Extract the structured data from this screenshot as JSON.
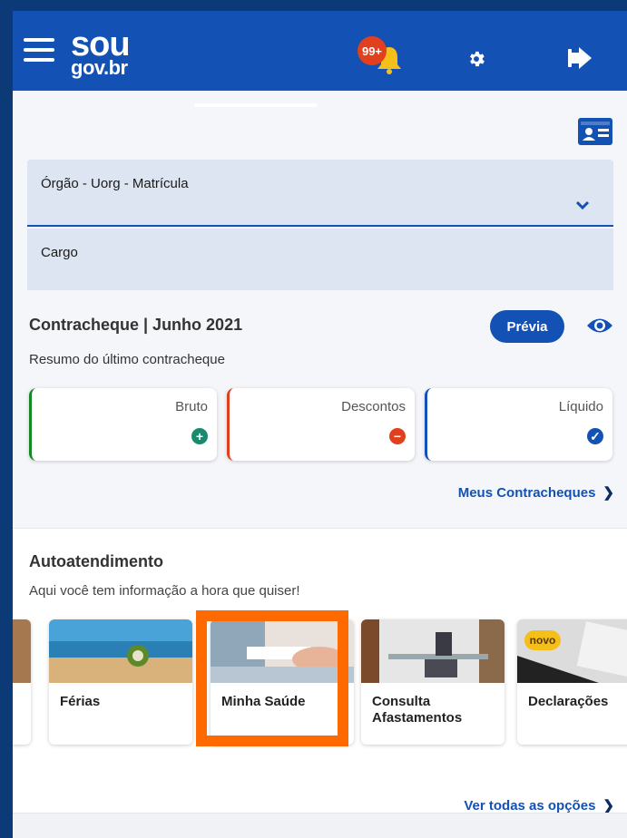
{
  "header": {
    "logo_top": "sou",
    "logo_bottom": "gov.br",
    "notification_count": "99+",
    "menu_icon": "hamburger-menu-icon",
    "bell_icon": "bell-icon",
    "settings_icon": "gear-icon",
    "logout_icon": "logout-icon"
  },
  "form": {
    "field1_label": "Órgão - Uorg - Matrícula",
    "field2_label": "Cargo"
  },
  "contracheque": {
    "title": "Contracheque | Junho 2021",
    "preview_button": "Prévia",
    "subtitle": "Resumo do último contracheque",
    "cards": [
      {
        "label": "Bruto",
        "icon": "+"
      },
      {
        "label": "Descontos",
        "icon": "−"
      },
      {
        "label": "Líquido",
        "icon": "✓"
      }
    ],
    "more_link": "Meus Contracheques"
  },
  "autoatendimento": {
    "title": "Autoatendimento",
    "subtitle": "Aqui você tem informação a hora que quiser!",
    "tiles": [
      {
        "label": ""
      },
      {
        "label": "Férias"
      },
      {
        "label": "Minha Saúde"
      },
      {
        "label": "Consulta Afastamentos"
      },
      {
        "label": "Declarações",
        "badge": "novo"
      }
    ],
    "all_link": "Ver todas as opções"
  },
  "colors": {
    "primary": "#1351b4",
    "highlight": "#ff6a00",
    "bruto": "#168821",
    "descontos": "#e0401d"
  }
}
